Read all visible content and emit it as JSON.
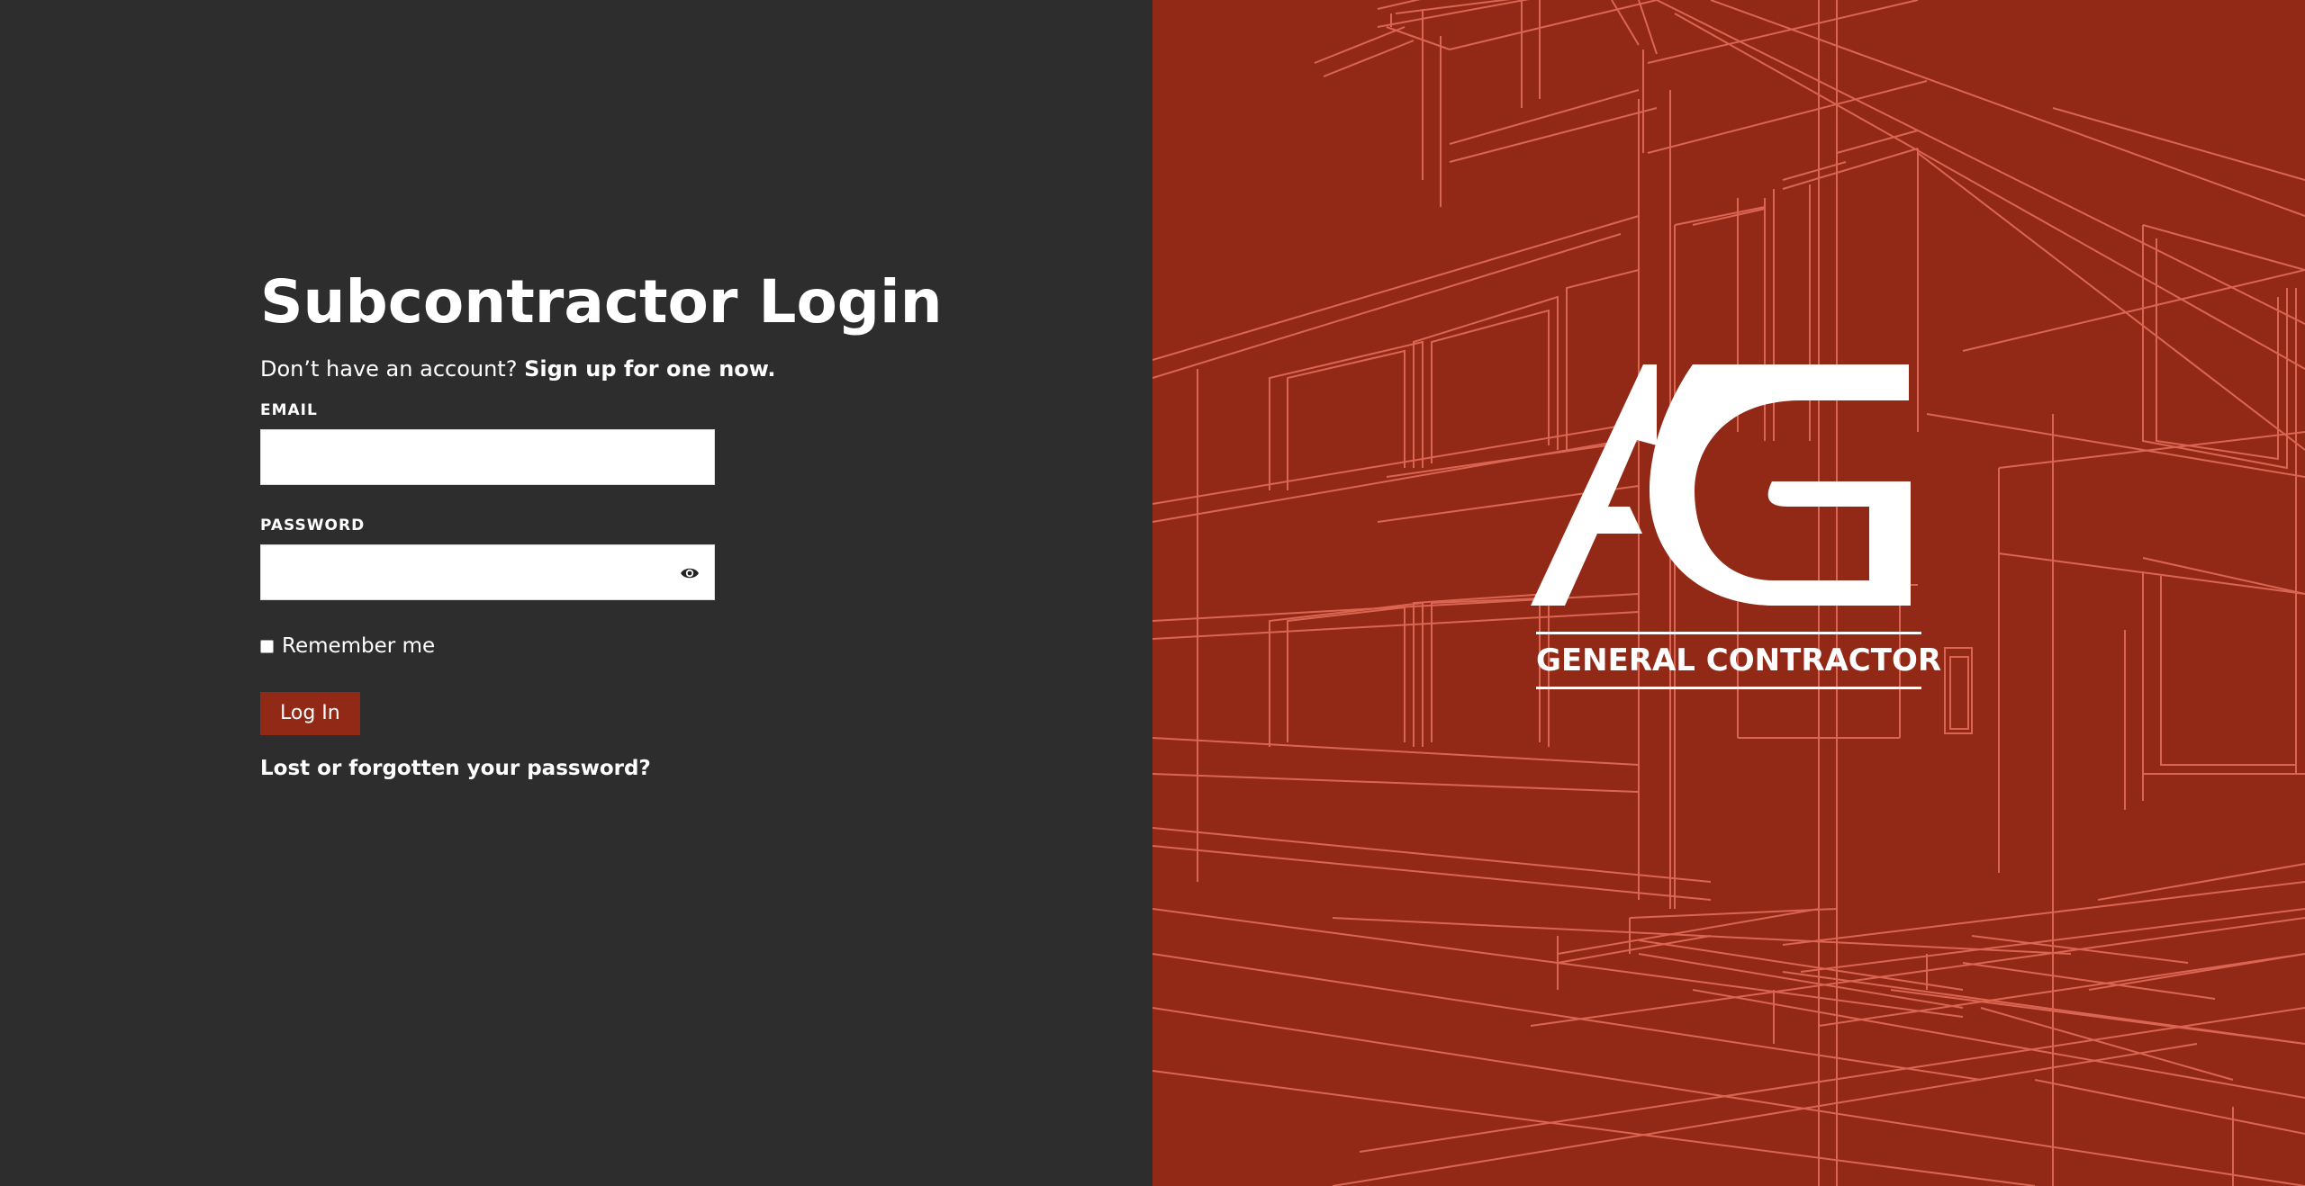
{
  "login": {
    "title": "Subcontractor Login",
    "signup_prompt": "Don’t have an account?",
    "signup_link": "Sign up for one now.",
    "email_label": "EMAIL",
    "email_value": "",
    "password_label": "PASSWORD",
    "password_value": "",
    "remember_label": "Remember me",
    "remember_checked": false,
    "login_button": "Log In",
    "lost_password_link": "Lost or forgotten your password?"
  },
  "brand": {
    "monogram": "AG",
    "name": "GENERAL CONTRACTOR"
  },
  "icons": {
    "password_toggle": "eye-icon"
  },
  "colors": {
    "left_background": "#2d2d2d",
    "right_background": "#922916",
    "accent": "#922916",
    "sketch_lines": "#e8705e",
    "text": "#ffffff"
  }
}
